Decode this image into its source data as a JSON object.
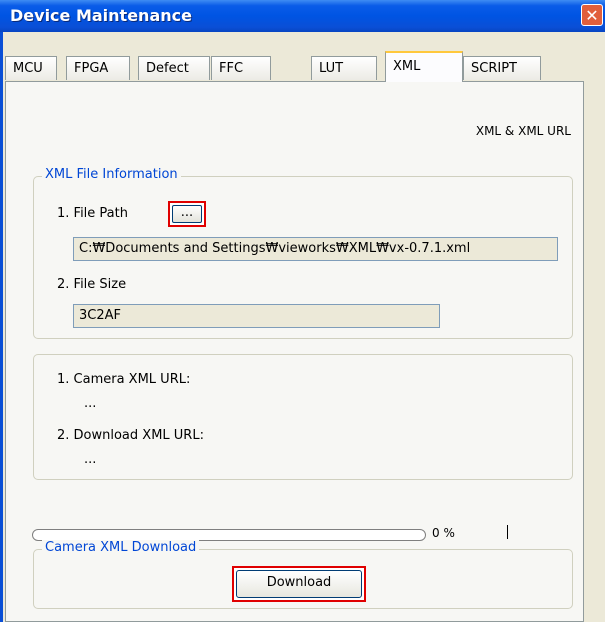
{
  "window": {
    "title": "Device Maintenance",
    "close_glyph": "✕"
  },
  "tabs": [
    {
      "label": "MCU"
    },
    {
      "label": "FPGA"
    },
    {
      "label": "Defect"
    },
    {
      "label": "FFC"
    },
    {
      "label": "LUT"
    },
    {
      "label": "XML",
      "active": true
    },
    {
      "label": "SCRIPT"
    }
  ],
  "header_label": "XML & XML URL",
  "file_info": {
    "group_title": "XML File Information",
    "file_path_label": "1. File Path",
    "browse_label": "...",
    "file_path_value": "C:₩Documents and Settings₩vieworks₩XML₩vx-0.7.1.xml",
    "file_size_label": "2. File Size",
    "file_size_value": "3C2AF"
  },
  "urls": {
    "camera_label": "1. Camera XML URL:",
    "camera_value": "...",
    "download_label": "2. Download XML URL:",
    "download_value": "..."
  },
  "progress": {
    "value": 0,
    "text": "0 %"
  },
  "download": {
    "group_title": "Camera XML Download",
    "button_label": "Download"
  },
  "icons": {
    "close": "close-icon"
  },
  "colors": {
    "titlebar": "#0054e3",
    "group_title": "#0046d5",
    "highlight": "#e00000",
    "active_tab_top": "#ffc83c"
  }
}
